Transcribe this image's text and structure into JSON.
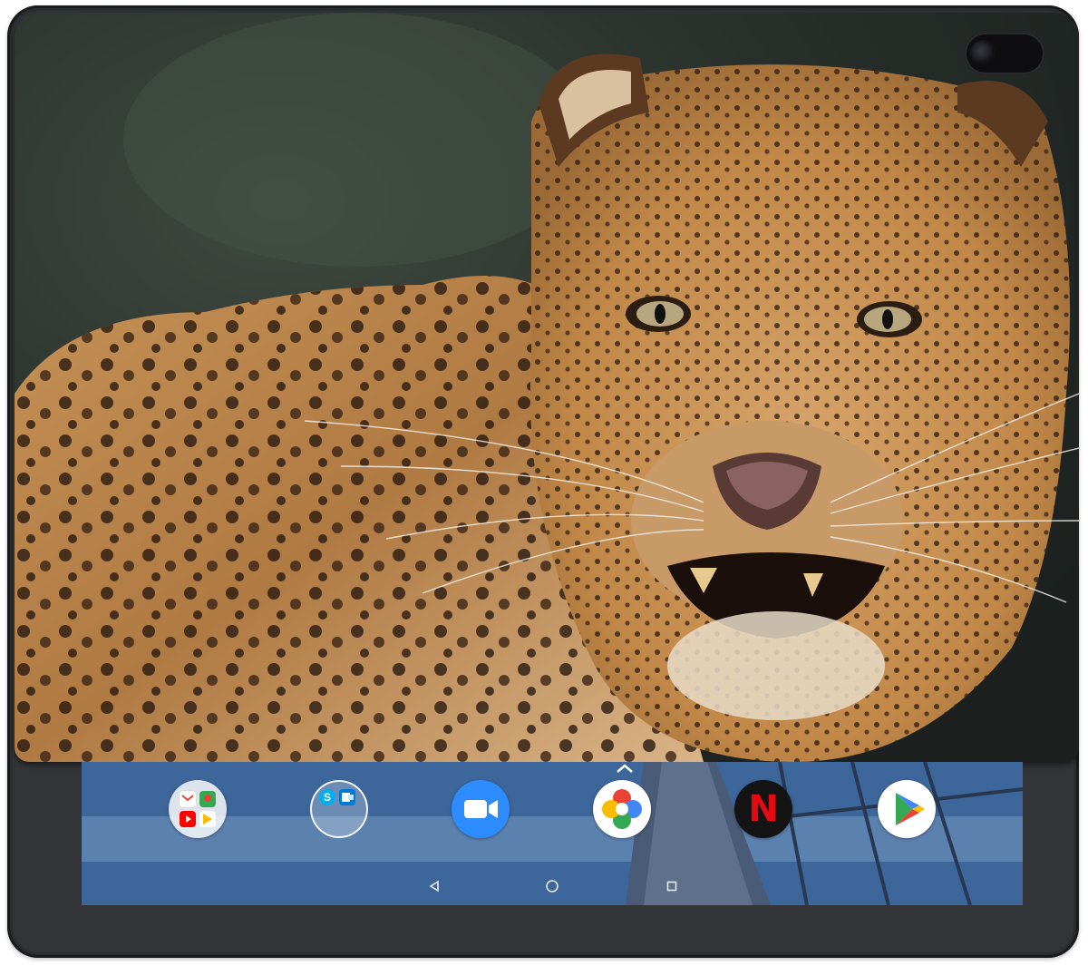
{
  "device": {
    "type": "tablet",
    "cover_subject": "leopard",
    "bezel_color": "#2c2d30"
  },
  "dock": {
    "apps": [
      {
        "name": "google-apps-folder",
        "icon": "folder-icon"
      },
      {
        "name": "skype-outlook-folder",
        "icon": "folder-icon"
      },
      {
        "name": "zoom",
        "icon": "video-camera-icon",
        "color": "#2d8cff"
      },
      {
        "name": "photos",
        "icon": "pinwheel-icon"
      },
      {
        "name": "netflix",
        "icon": "netflix-icon",
        "glyph": "N",
        "color": "#e50914"
      },
      {
        "name": "google-play",
        "icon": "play-store-icon"
      }
    ],
    "expand_icon": "chevron-up-icon"
  },
  "navbar": {
    "back_icon": "back-triangle-icon",
    "home_icon": "home-circle-icon",
    "recents_icon": "recents-square-icon"
  }
}
